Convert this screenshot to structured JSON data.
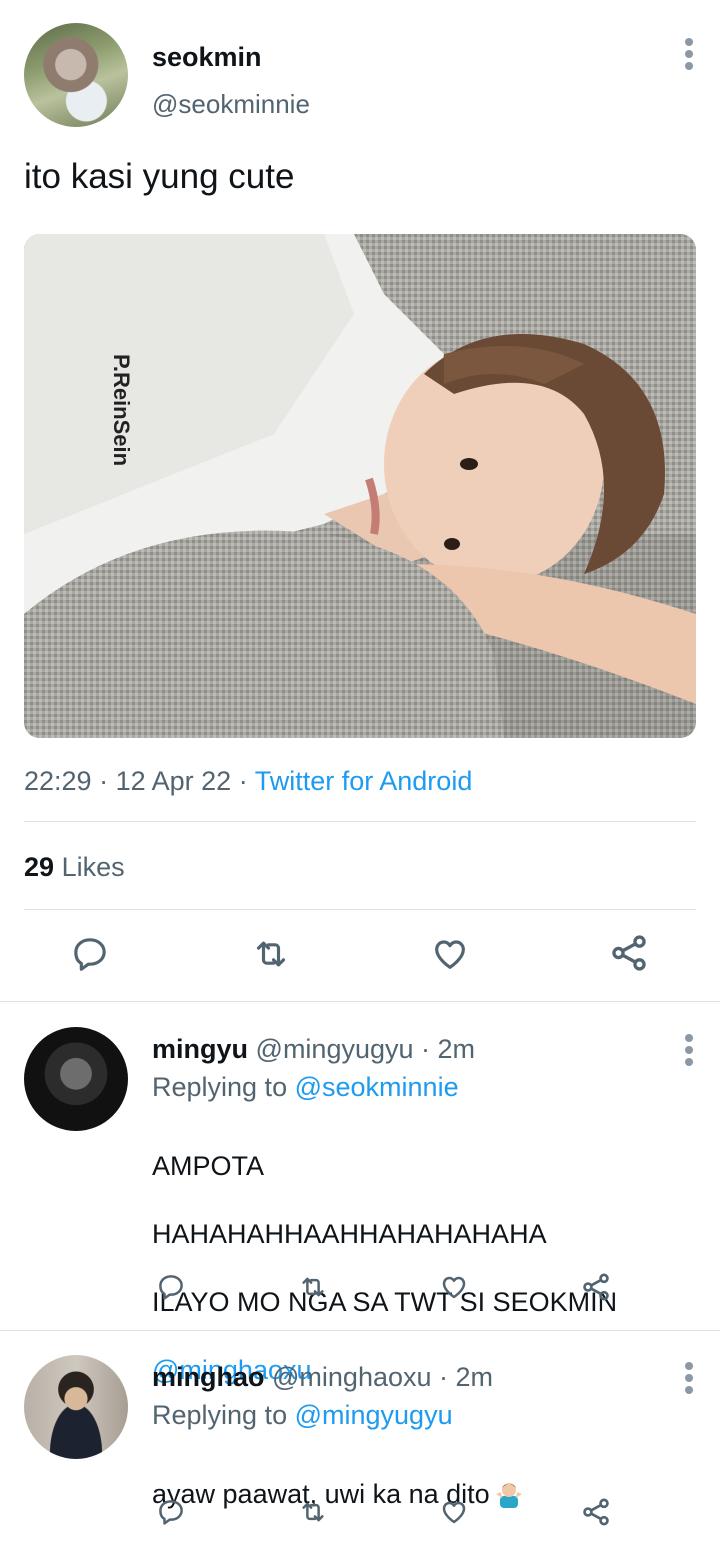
{
  "tweet": {
    "author_name": "seokmin",
    "author_handle": "@seokminnie",
    "text": "ito kasi yung cute",
    "photo_shirt_print": "P.ReinSein",
    "time": "22:29",
    "separator": "·",
    "date": "12 Apr 22",
    "source": "Twitter for Android",
    "likes_count": "29",
    "likes_label": "Likes",
    "actions": [
      "reply-icon",
      "retweet-icon",
      "like-icon",
      "share-icon"
    ]
  },
  "replies": [
    {
      "name": "mingyu",
      "handle": "@mingyugyu",
      "time": "· 2m",
      "replying_prefix": "Replying to",
      "replying_to": "@seokminnie",
      "text_line1": "AMPOTA",
      "text_line2": "HAHAHAHHAAHHAHAHAHAHA",
      "text_line3": "ILAYO MO NGA SA TWT SI SEOKMIN",
      "mention": "@minghaoxu"
    },
    {
      "name": "minghao",
      "handle": "@minghaoxu",
      "time": "· 2m",
      "replying_prefix": "Replying to",
      "replying_to": "@mingyugyu",
      "text": "ayaw paawat, uwi ka na dito",
      "emoji": "person-shrugging-emoji"
    }
  ],
  "colors": {
    "text": "#0f1419",
    "secondary": "#536471",
    "link": "#1d9bf0",
    "divider": "#dfe3e6"
  }
}
